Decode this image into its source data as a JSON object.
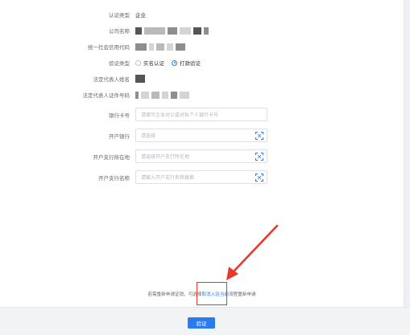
{
  "form": {
    "cert_type": {
      "label": "认证类型",
      "value": "企业"
    },
    "company_name": {
      "label": "公司名称"
    },
    "credit_code": {
      "label": "统一社会信用代码"
    },
    "verify_type": {
      "label": "验证类型",
      "options": [
        {
          "label": "实名认证",
          "selected": false
        },
        {
          "label": "打款验证",
          "selected": true
        }
      ]
    },
    "legal_rep_name": {
      "label": "法定代表人姓名"
    },
    "legal_rep_id": {
      "label": "法定代表人证件号码"
    },
    "bank_card": {
      "label": "银行卡号",
      "placeholder": "请填写企业对公或对私个人银行卡号"
    },
    "bank": {
      "label": "开户银行",
      "placeholder": "请选择"
    },
    "branch_location": {
      "label": "开户支行所在地",
      "placeholder": "请选择开户支行所在地"
    },
    "branch_name": {
      "label": "开户支行名称",
      "placeholder": "请输入开户支行名称搜索"
    }
  },
  "notice": {
    "prefix": "若需重新申请证销，可选择",
    "link": "取消入驻当前",
    "suffix": "流程重新申请"
  },
  "footer": {
    "submit_label": "验证"
  },
  "colors": {
    "accent": "#2a7af0",
    "annotation": "#e8382c"
  },
  "icons": {
    "scan": "scan-icon"
  }
}
